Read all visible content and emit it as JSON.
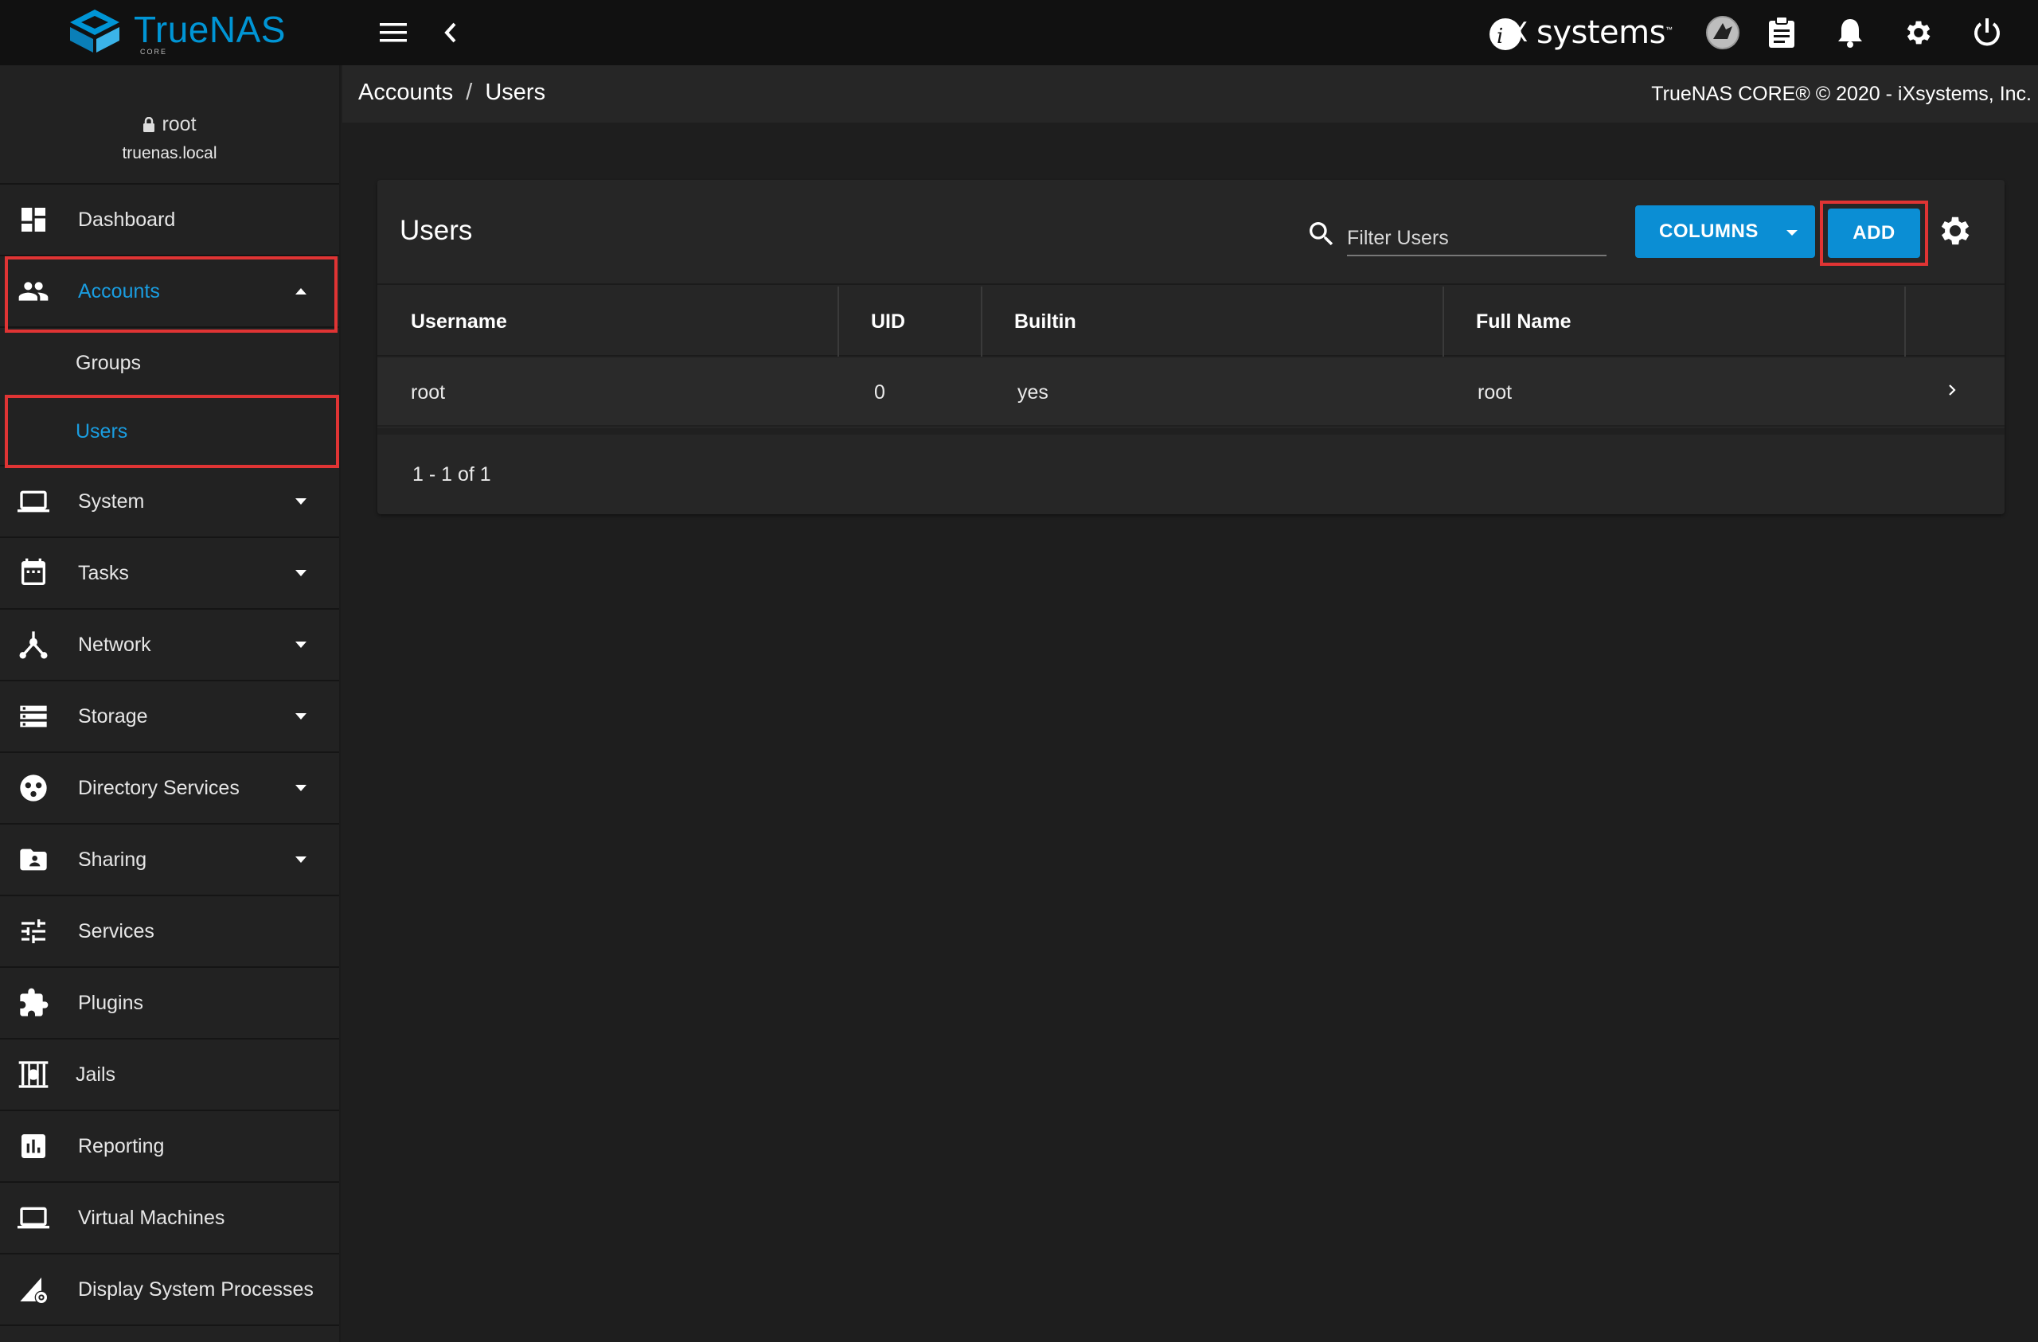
{
  "app": {
    "brand_word": "TrueNAS",
    "brand_sub": "CORE",
    "vendor_word": "systems",
    "vendor_tm": "™"
  },
  "sidebar": {
    "user": "root",
    "host": "truenas.local",
    "items": [
      {
        "label": "Dashboard",
        "icon": "dashboard-icon"
      },
      {
        "label": "Accounts",
        "icon": "people-icon",
        "expanded": true,
        "active": true
      },
      {
        "label": "System",
        "icon": "laptop-icon"
      },
      {
        "label": "Tasks",
        "icon": "calendar-icon"
      },
      {
        "label": "Network",
        "icon": "network-icon"
      },
      {
        "label": "Storage",
        "icon": "storage-icon"
      },
      {
        "label": "Directory Services",
        "icon": "directory-icon"
      },
      {
        "label": "Sharing",
        "icon": "folder-share-icon"
      },
      {
        "label": "Services",
        "icon": "tune-icon"
      },
      {
        "label": "Plugins",
        "icon": "puzzle-icon"
      },
      {
        "label": "Jails",
        "icon": "jail-icon"
      },
      {
        "label": "Reporting",
        "icon": "chart-icon"
      },
      {
        "label": "Virtual Machines",
        "icon": "monitor-icon"
      },
      {
        "label": "Display System Processes",
        "icon": "processes-icon"
      }
    ],
    "accounts_sub": [
      {
        "label": "Groups"
      },
      {
        "label": "Users",
        "active": true
      }
    ]
  },
  "breadcrumb": {
    "parent": "Accounts",
    "separator": "/",
    "current": "Users"
  },
  "copyright": "TrueNAS CORE® © 2020 - iXsystems, Inc.",
  "users_card": {
    "title": "Users",
    "filter_placeholder": "Filter Users",
    "columns_label": "COLUMNS",
    "add_label": "ADD",
    "headers": [
      "Username",
      "UID",
      "Builtin",
      "Full Name"
    ],
    "rows": [
      {
        "username": "root",
        "uid": "0",
        "builtin": "yes",
        "full_name": "root"
      }
    ],
    "pager": "1 - 1 of 1"
  },
  "colors": {
    "accent": "#0b8ed4",
    "active_text": "#1a9de0",
    "highlight": "#e03434",
    "topbar": "#111111",
    "sidebar": "#222222"
  }
}
